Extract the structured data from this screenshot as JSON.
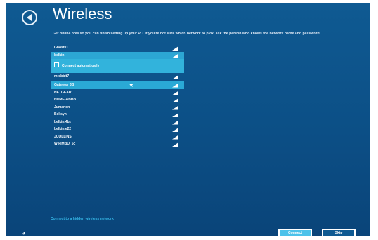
{
  "header": {
    "title": "Wireless"
  },
  "instructions": "Get online now so you can finish setting up your PC. If you're not sure which network to pick, ask the person who knows the network name and password.",
  "networks": [
    {
      "name": "Ghost01"
    },
    {
      "name": "belkin"
    },
    {
      "name": "mrabbit7"
    },
    {
      "name": "Gateway 3B"
    },
    {
      "name": "NETGEAR"
    },
    {
      "name": "HOME-ABBB"
    },
    {
      "name": "Jumanon"
    },
    {
      "name": "Bellsyn"
    },
    {
      "name": "belkin.4bz"
    },
    {
      "name": "belkin.e22"
    },
    {
      "name": "JCOLLINS"
    },
    {
      "name": "WIFIMBU_5c"
    }
  ],
  "connect_panel": {
    "auto_connect_label": "Connect automatically"
  },
  "hidden_network_link": "Connect to a hidden wireless network",
  "buttons": {
    "connect": "Connect",
    "skip": "Skip"
  },
  "icons": {
    "back": "back-arrow-icon",
    "signal": "wifi-signal-icon",
    "ease_of_access": "ease-of-access-icon",
    "cursor": "mouse-cursor-icon"
  },
  "colors": {
    "background": "#0c4f86",
    "highlight": "#2ca6d4",
    "accent_button": "#4cc2ea",
    "link": "#35b8e8"
  }
}
